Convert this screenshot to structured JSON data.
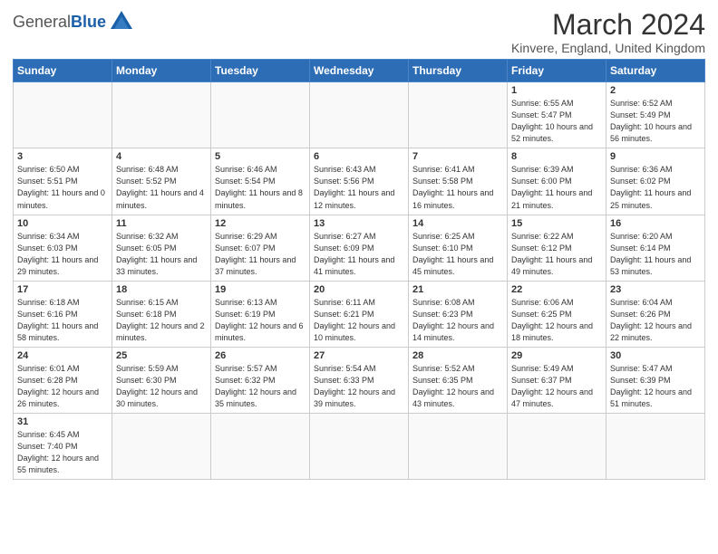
{
  "header": {
    "logo_general": "General",
    "logo_blue": "Blue",
    "month": "March 2024",
    "location": "Kinvere, England, United Kingdom"
  },
  "weekdays": [
    "Sunday",
    "Monday",
    "Tuesday",
    "Wednesday",
    "Thursday",
    "Friday",
    "Saturday"
  ],
  "weeks": [
    [
      {
        "day": "",
        "info": ""
      },
      {
        "day": "",
        "info": ""
      },
      {
        "day": "",
        "info": ""
      },
      {
        "day": "",
        "info": ""
      },
      {
        "day": "",
        "info": ""
      },
      {
        "day": "1",
        "info": "Sunrise: 6:55 AM\nSunset: 5:47 PM\nDaylight: 10 hours and 52 minutes."
      },
      {
        "day": "2",
        "info": "Sunrise: 6:52 AM\nSunset: 5:49 PM\nDaylight: 10 hours and 56 minutes."
      }
    ],
    [
      {
        "day": "3",
        "info": "Sunrise: 6:50 AM\nSunset: 5:51 PM\nDaylight: 11 hours and 0 minutes."
      },
      {
        "day": "4",
        "info": "Sunrise: 6:48 AM\nSunset: 5:52 PM\nDaylight: 11 hours and 4 minutes."
      },
      {
        "day": "5",
        "info": "Sunrise: 6:46 AM\nSunset: 5:54 PM\nDaylight: 11 hours and 8 minutes."
      },
      {
        "day": "6",
        "info": "Sunrise: 6:43 AM\nSunset: 5:56 PM\nDaylight: 11 hours and 12 minutes."
      },
      {
        "day": "7",
        "info": "Sunrise: 6:41 AM\nSunset: 5:58 PM\nDaylight: 11 hours and 16 minutes."
      },
      {
        "day": "8",
        "info": "Sunrise: 6:39 AM\nSunset: 6:00 PM\nDaylight: 11 hours and 21 minutes."
      },
      {
        "day": "9",
        "info": "Sunrise: 6:36 AM\nSunset: 6:02 PM\nDaylight: 11 hours and 25 minutes."
      }
    ],
    [
      {
        "day": "10",
        "info": "Sunrise: 6:34 AM\nSunset: 6:03 PM\nDaylight: 11 hours and 29 minutes."
      },
      {
        "day": "11",
        "info": "Sunrise: 6:32 AM\nSunset: 6:05 PM\nDaylight: 11 hours and 33 minutes."
      },
      {
        "day": "12",
        "info": "Sunrise: 6:29 AM\nSunset: 6:07 PM\nDaylight: 11 hours and 37 minutes."
      },
      {
        "day": "13",
        "info": "Sunrise: 6:27 AM\nSunset: 6:09 PM\nDaylight: 11 hours and 41 minutes."
      },
      {
        "day": "14",
        "info": "Sunrise: 6:25 AM\nSunset: 6:10 PM\nDaylight: 11 hours and 45 minutes."
      },
      {
        "day": "15",
        "info": "Sunrise: 6:22 AM\nSunset: 6:12 PM\nDaylight: 11 hours and 49 minutes."
      },
      {
        "day": "16",
        "info": "Sunrise: 6:20 AM\nSunset: 6:14 PM\nDaylight: 11 hours and 53 minutes."
      }
    ],
    [
      {
        "day": "17",
        "info": "Sunrise: 6:18 AM\nSunset: 6:16 PM\nDaylight: 11 hours and 58 minutes."
      },
      {
        "day": "18",
        "info": "Sunrise: 6:15 AM\nSunset: 6:18 PM\nDaylight: 12 hours and 2 minutes."
      },
      {
        "day": "19",
        "info": "Sunrise: 6:13 AM\nSunset: 6:19 PM\nDaylight: 12 hours and 6 minutes."
      },
      {
        "day": "20",
        "info": "Sunrise: 6:11 AM\nSunset: 6:21 PM\nDaylight: 12 hours and 10 minutes."
      },
      {
        "day": "21",
        "info": "Sunrise: 6:08 AM\nSunset: 6:23 PM\nDaylight: 12 hours and 14 minutes."
      },
      {
        "day": "22",
        "info": "Sunrise: 6:06 AM\nSunset: 6:25 PM\nDaylight: 12 hours and 18 minutes."
      },
      {
        "day": "23",
        "info": "Sunrise: 6:04 AM\nSunset: 6:26 PM\nDaylight: 12 hours and 22 minutes."
      }
    ],
    [
      {
        "day": "24",
        "info": "Sunrise: 6:01 AM\nSunset: 6:28 PM\nDaylight: 12 hours and 26 minutes."
      },
      {
        "day": "25",
        "info": "Sunrise: 5:59 AM\nSunset: 6:30 PM\nDaylight: 12 hours and 30 minutes."
      },
      {
        "day": "26",
        "info": "Sunrise: 5:57 AM\nSunset: 6:32 PM\nDaylight: 12 hours and 35 minutes."
      },
      {
        "day": "27",
        "info": "Sunrise: 5:54 AM\nSunset: 6:33 PM\nDaylight: 12 hours and 39 minutes."
      },
      {
        "day": "28",
        "info": "Sunrise: 5:52 AM\nSunset: 6:35 PM\nDaylight: 12 hours and 43 minutes."
      },
      {
        "day": "29",
        "info": "Sunrise: 5:49 AM\nSunset: 6:37 PM\nDaylight: 12 hours and 47 minutes."
      },
      {
        "day": "30",
        "info": "Sunrise: 5:47 AM\nSunset: 6:39 PM\nDaylight: 12 hours and 51 minutes."
      }
    ],
    [
      {
        "day": "31",
        "info": "Sunrise: 6:45 AM\nSunset: 7:40 PM\nDaylight: 12 hours and 55 minutes."
      },
      {
        "day": "",
        "info": ""
      },
      {
        "day": "",
        "info": ""
      },
      {
        "day": "",
        "info": ""
      },
      {
        "day": "",
        "info": ""
      },
      {
        "day": "",
        "info": ""
      },
      {
        "day": "",
        "info": ""
      }
    ]
  ]
}
